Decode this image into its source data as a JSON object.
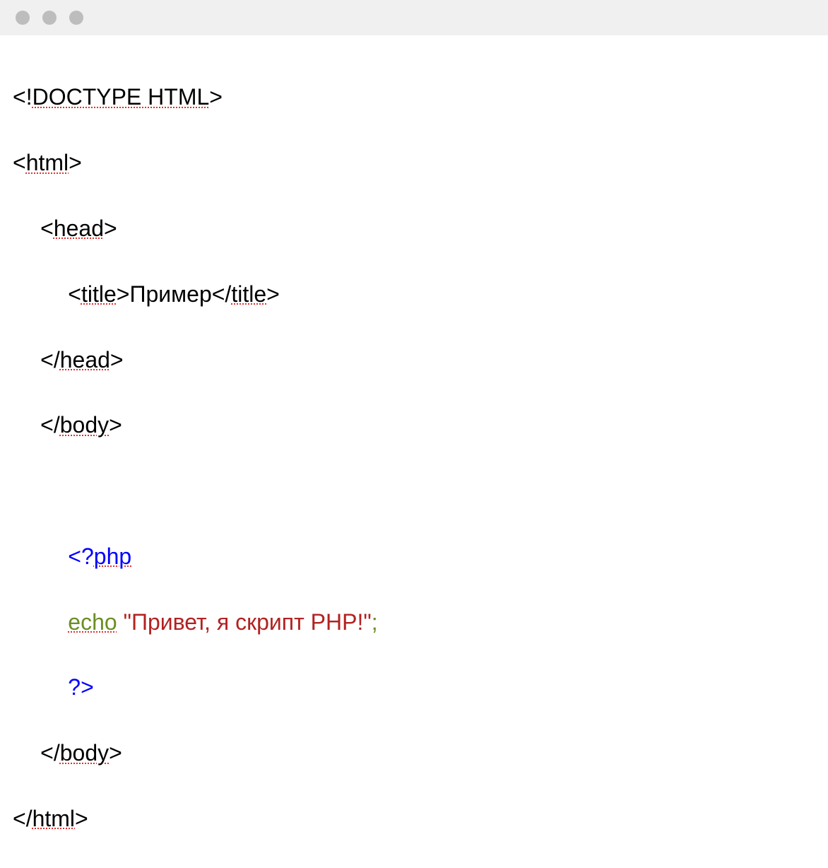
{
  "code": {
    "l1_a": "<!",
    "l1_b": "DOCTYPE HTML",
    "l1_c": ">",
    "l2_a": "<",
    "l2_b": "html",
    "l2_c": ">",
    "l3_a": "<",
    "l3_b": "head",
    "l3_c": ">",
    "l4_a": "<",
    "l4_b": "title",
    "l4_c": ">",
    "l4_d": "Пример",
    "l4_e": "</",
    "l4_f": "title",
    "l4_g": ">",
    "l5_a": "</",
    "l5_b": "head",
    "l5_c": ">",
    "l6_a": "</",
    "l6_b": "body",
    "l6_c": ">",
    "l8_a": "<?",
    "l8_b": "php",
    "l9_a": "echo",
    "l9_sp": " ",
    "l9_b": "\"Привет, я скрипт PHP!\"",
    "l9_c": ";",
    "l10_a": "?>",
    "l11_a": "</",
    "l11_b": "body",
    "l11_c": ">",
    "l12_a": "</",
    "l12_b": "html",
    "l12_c": ">"
  }
}
